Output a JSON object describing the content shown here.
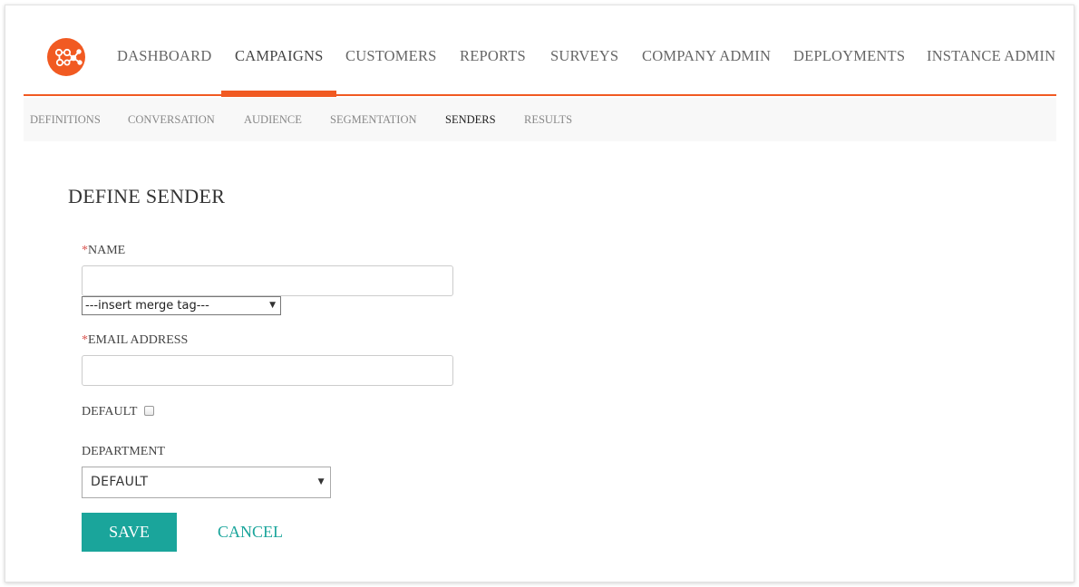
{
  "nav": {
    "items": [
      "DASHBOARD",
      "CAMPAIGNS",
      "CUSTOMERS",
      "REPORTS",
      "SURVEYS",
      "COMPANY ADMIN",
      "DEPLOYMENTS",
      "INSTANCE ADMIN"
    ],
    "active": "CAMPAIGNS"
  },
  "subnav": {
    "items": [
      "DEFINITIONS",
      "CONVERSATION",
      "AUDIENCE",
      "SEGMENTATION",
      "SENDERS",
      "RESULTS"
    ],
    "active": "SENDERS"
  },
  "form": {
    "title": "DEFINE SENDER",
    "required_marker": "*",
    "name_label": "NAME",
    "name_value": "",
    "merge_tag_selected": "---insert merge tag---",
    "email_label": "EMAIL ADDRESS",
    "email_value": "",
    "default_label": "DEFAULT",
    "default_checked": false,
    "department_label": "DEPARTMENT",
    "department_selected": "DEFAULT",
    "save_label": "SAVE",
    "cancel_label": "CANCEL"
  },
  "colors": {
    "accent": "#f15a22",
    "primary_button": "#1aa59b",
    "required": "#d9534f"
  },
  "icons": {
    "logo": "network-nodes-icon",
    "select_arrow": "caret-down-icon"
  }
}
